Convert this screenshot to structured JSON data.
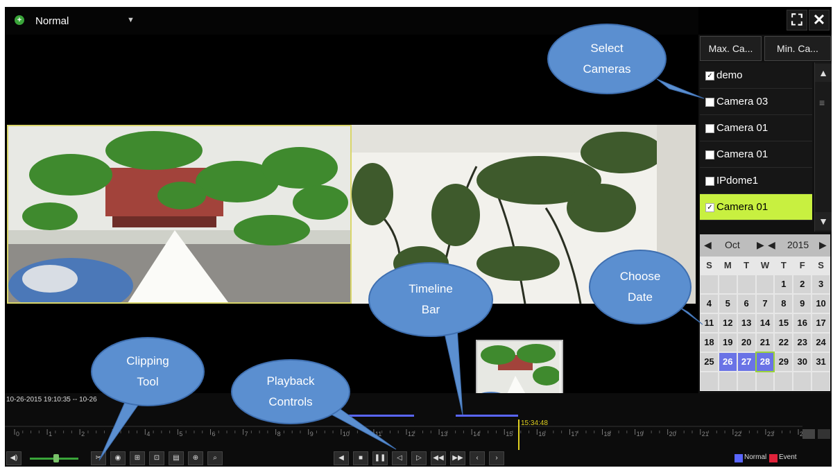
{
  "topbar": {
    "mode_label": "Normal",
    "fullscreen_icon": "fullscreen-icon",
    "close_icon": "close-icon"
  },
  "camera_panel": {
    "max_label": "Max. Ca...",
    "min_label": "Min. Ca...",
    "cameras": [
      {
        "label": "demo",
        "checked": true
      },
      {
        "label": "Camera 03",
        "checked": false
      },
      {
        "label": "Camera 01",
        "checked": false
      },
      {
        "label": "Camera 01",
        "checked": false
      },
      {
        "label": "IPdome1",
        "checked": false
      },
      {
        "label": "Camera 01",
        "checked": true,
        "selected": true
      }
    ]
  },
  "calendar": {
    "month": "Oct",
    "year": "2015",
    "weekdays": [
      "S",
      "M",
      "T",
      "W",
      "T",
      "F",
      "S"
    ],
    "days": [
      "",
      "",
      "",
      "",
      "1",
      "2",
      "3",
      "4",
      "5",
      "6",
      "7",
      "8",
      "9",
      "10",
      "11",
      "12",
      "13",
      "14",
      "15",
      "16",
      "17",
      "18",
      "19",
      "20",
      "21",
      "22",
      "23",
      "24",
      "25",
      "26",
      "27",
      "28",
      "29",
      "30",
      "31",
      "",
      "",
      "",
      "",
      "",
      "",
      ""
    ],
    "recorded_days": [
      "26",
      "27",
      "28"
    ],
    "selected_day": "28"
  },
  "timeline": {
    "time_range": "10-26-2015 19:10:35 -- 10-26",
    "cursor_time": "15:34:48",
    "hour_labels": [
      "0",
      "1",
      "2",
      "3",
      "4",
      "5",
      "6",
      "7",
      "8",
      "9",
      "10",
      "11",
      "12",
      "13",
      "14",
      "15",
      "16",
      "17",
      "18",
      "19",
      "20",
      "21",
      "22",
      "23",
      "24"
    ],
    "legend_normal": "Normal",
    "legend_event": "Event",
    "normal_color": "#5a66ff",
    "event_color": "#e0223a"
  },
  "callouts": {
    "select_cameras": "Select\nCameras",
    "choose_date": "Choose\nDate",
    "timeline_bar": "Timeline\nBar",
    "clipping_tool": "Clipping\nTool",
    "playback_controls": "Playback\nControls"
  },
  "colors": {
    "callout": "#5b8fd0",
    "selected_row": "#c8f040",
    "recorded_day": "#6a73e6"
  }
}
